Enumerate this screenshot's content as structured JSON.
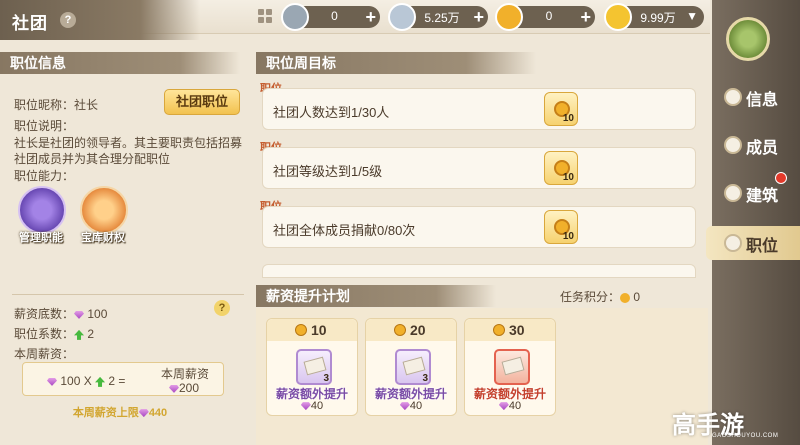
{
  "header": {
    "title": "社团",
    "help": "?"
  },
  "currencies": [
    {
      "value": "0",
      "icon": "silver-medal-icon",
      "color": "#9aa7b3"
    },
    {
      "value": "5.25万",
      "icon": "silver-coin-icon",
      "color": "#b9c7d6"
    },
    {
      "value": "0",
      "icon": "gold-coin-icon",
      "color": "#f1b02b"
    },
    {
      "value": "9.99万",
      "icon": "gold-gem-icon",
      "color": "#f4c430"
    }
  ],
  "left": {
    "section_title": "职位信息",
    "nickname": "职位昵称：社长",
    "button": "社团职位",
    "desc_label": "职位说明：",
    "desc": "社长是社团的领导者。其主要职责包括招募社团成员并为其合理分配职位",
    "ability_label": "职位能力：",
    "abilities": [
      "管理职能",
      "宝库财权"
    ],
    "base_label": "薪资底数：",
    "base_value": "100",
    "coef_label": "职位系数：",
    "coef_value": "2",
    "weekly_label": "本周薪资：",
    "formula_a": "100 X",
    "formula_b": "2 =",
    "weekly_title": "本周薪资",
    "weekly_value": "200",
    "cap": "本周薪资上限",
    "cap_value": "440",
    "help": "?"
  },
  "goals": {
    "section_title": "职位周目标",
    "items": [
      {
        "tag": "职位",
        "text": "社团人数达到1/30人",
        "reward": "10"
      },
      {
        "tag": "职位",
        "text": "社团等级达到1/5级",
        "reward": "10"
      },
      {
        "tag": "职位",
        "text": "社团全体成员捐献0/80次",
        "reward": "10"
      }
    ]
  },
  "salary": {
    "section_title": "薪资提升计划",
    "score_label": "任务积分：",
    "score": "0",
    "cards": [
      {
        "cost": "10",
        "count": "3",
        "title": "薪资额外提升",
        "value": "40"
      },
      {
        "cost": "20",
        "count": "3",
        "title": "薪资额外提升",
        "value": "40"
      },
      {
        "cost": "30",
        "count": "",
        "title": "薪资额外提升",
        "value": "40"
      }
    ]
  },
  "nav": [
    {
      "label": "信息",
      "icon": "chat-icon"
    },
    {
      "label": "成员",
      "icon": "members-icon"
    },
    {
      "label": "建筑",
      "icon": "building-icon"
    },
    {
      "label": "职位",
      "icon": "position-icon"
    }
  ],
  "watermark": {
    "text": "高手游",
    "sub": "GAOSHOUYOU.COM"
  }
}
